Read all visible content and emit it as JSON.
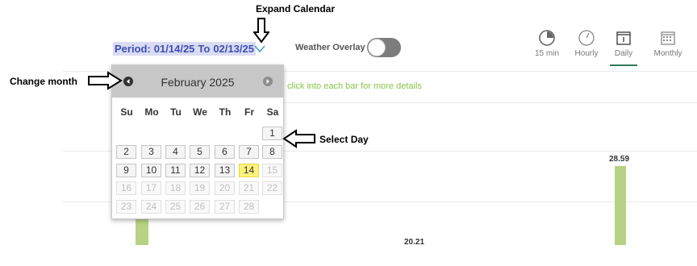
{
  "header": {
    "period": {
      "prefix": "Period:",
      "start": "01/14/25",
      "separator": "To",
      "end": "02/13/25"
    },
    "weather_overlay": {
      "label": "Weather Overlay",
      "enabled": false
    },
    "views": [
      {
        "label": "15 min",
        "icon": "pie-clock-icon",
        "selected": false
      },
      {
        "label": "Hourly",
        "icon": "clock-icon",
        "selected": false
      },
      {
        "label": "Daily",
        "icon": "calendar-day-icon",
        "selected": true
      },
      {
        "label": "Monthly",
        "icon": "calendar-month-icon",
        "selected": false
      }
    ]
  },
  "chart": {
    "hint": "click into each bar for more details",
    "values": [
      "28.59",
      "20.21"
    ]
  },
  "calendar": {
    "month_title": "February 2025",
    "prev_icon": "prev-month-icon",
    "next_icon": "next-month-icon",
    "weekdays": [
      "Su",
      "Mo",
      "Tu",
      "We",
      "Th",
      "Fr",
      "Sa"
    ],
    "weeks": [
      [
        "",
        "",
        "",
        "",
        "",
        "",
        "1"
      ],
      [
        "2",
        "3",
        "4",
        "5",
        "6",
        "7",
        "8"
      ],
      [
        "9",
        "10",
        "11",
        "12",
        "13",
        "14",
        "15"
      ],
      [
        "16",
        "17",
        "18",
        "19",
        "20",
        "21",
        "22"
      ],
      [
        "23",
        "24",
        "25",
        "26",
        "27",
        "28",
        ""
      ]
    ],
    "today": "14",
    "last_selectable_day": "14"
  },
  "annotations": {
    "expand_calendar": "Expand Calendar",
    "change_month": "Change month",
    "select_day": "Select Day"
  },
  "colors": {
    "period_text": "#3f4fb3",
    "hint_text": "#8bc34a",
    "bar": "#b7d282",
    "today_highlight": "#fff27a",
    "selected_view_underline": "#2f7a57"
  }
}
